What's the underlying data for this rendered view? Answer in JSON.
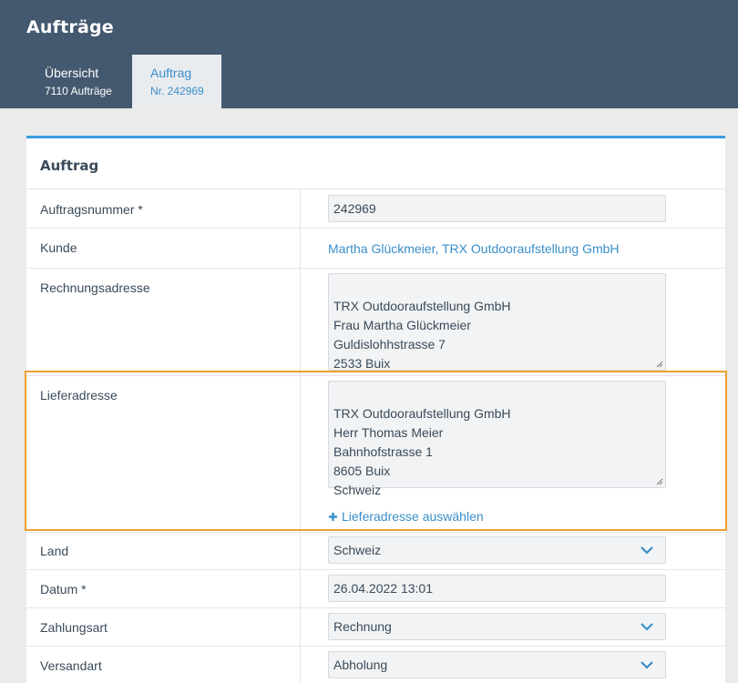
{
  "header": {
    "title": "Aufträge",
    "tabs": [
      {
        "label": "Übersicht",
        "sub": "7110 Aufträge",
        "active": false
      },
      {
        "label": "Auftrag",
        "sub": "Nr. 242969",
        "active": true
      }
    ]
  },
  "card": {
    "title": "Auftrag",
    "fields": {
      "order_number": {
        "label": "Auftragsnummer *",
        "value": "242969"
      },
      "customer": {
        "label": "Kunde",
        "value": "Martha Glückmeier, TRX Outdooraufstellung GmbH"
      },
      "billing_address": {
        "label": "Rechnungsadresse",
        "value": "TRX Outdooraufstellung GmbH\nFrau Martha Glückmeier\nGuldislohhstrasse 7\n2533 Buix"
      },
      "delivery_address": {
        "label": "Lieferadresse",
        "value": "TRX Outdooraufstellung GmbH\nHerr Thomas Meier\nBahnhofstrasse 1\n8605 Buix\nSchweiz",
        "action": "Lieferadresse auswählen"
      },
      "country": {
        "label": "Land",
        "value": "Schweiz"
      },
      "date": {
        "label": "Datum *",
        "value": "26.04.2022 13:01"
      },
      "payment": {
        "label": "Zahlungsart",
        "value": "Rechnung"
      },
      "shipping": {
        "label": "Versandart",
        "value": "Abholung"
      }
    }
  },
  "colors": {
    "header_bg": "#44596f",
    "accent": "#3a9de0",
    "link": "#3a8fc9",
    "highlight": "#f0a030"
  }
}
